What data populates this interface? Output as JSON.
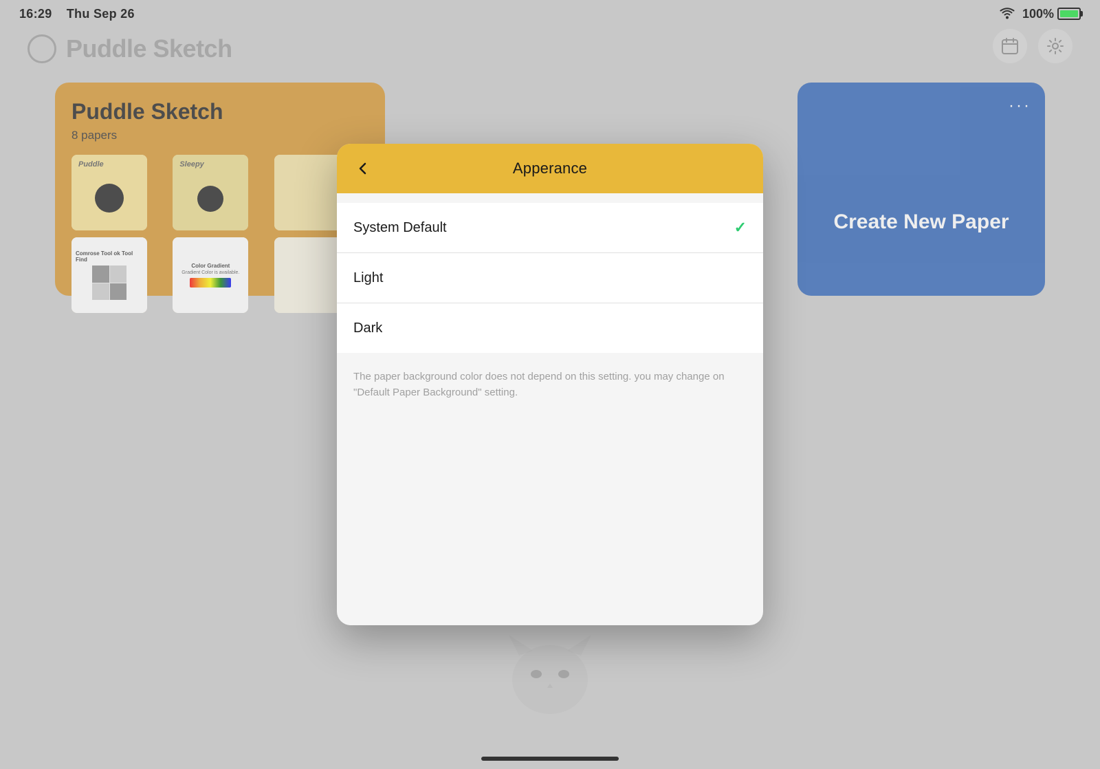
{
  "statusBar": {
    "time": "16:29",
    "date": "Thu Sep 26",
    "battery": "100%"
  },
  "app": {
    "logoText": "Puddle Sketch",
    "notebookCard": {
      "title": "Puddle Sketch",
      "subtitle": "8 papers",
      "thumbnails": [
        {
          "label": "Puddle"
        },
        {
          "label": "Sleepy"
        },
        {
          "label": ""
        },
        {
          "label": "Comrose Tool ok Tool Find"
        },
        {
          "label": "Color Gradient"
        },
        {
          "label": ""
        }
      ]
    },
    "blueCard": {
      "dots": "···",
      "label": "Create New Paper"
    }
  },
  "modal": {
    "title": "Apperance",
    "backLabel": "‹",
    "options": [
      {
        "label": "System Default",
        "selected": true
      },
      {
        "label": "Light",
        "selected": false
      },
      {
        "label": "Dark",
        "selected": false
      }
    ],
    "note": "The paper background color does not depend on this setting. you may change on \"Default Paper Background\" setting."
  }
}
